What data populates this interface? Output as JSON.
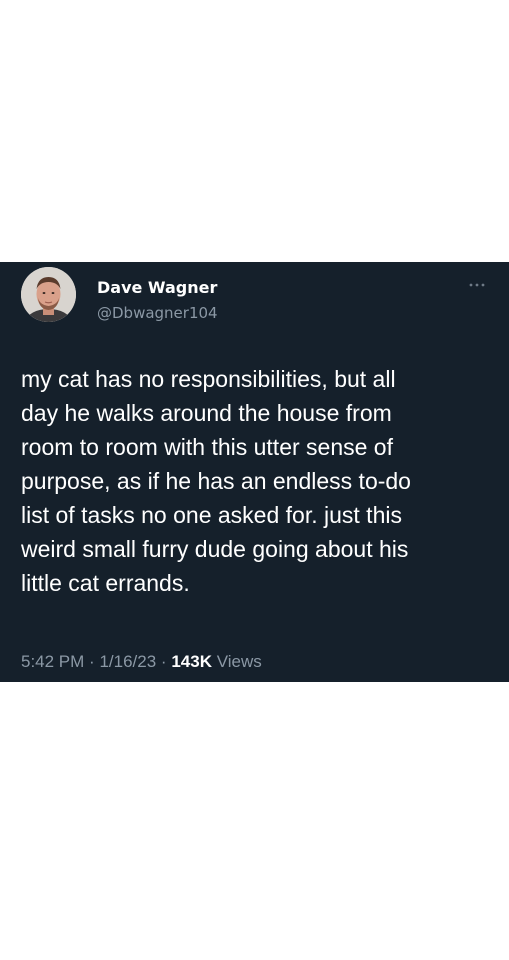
{
  "tweet": {
    "author": {
      "name": "Dave Wagner",
      "handle": "@Dbwagner104"
    },
    "more_icon": "more-horizontal-icon",
    "text": "my cat has no responsibilities, but all\nday he walks around the house from\nroom to room with this utter sense of\npurpose, as if he has an endless to-do\nlist of tasks no one asked for. just this\nweird small furry dude going about his\nlittle cat errands.",
    "meta": {
      "time": "5:42 PM",
      "separator": "·",
      "date": "1/16/23",
      "views_count": "143K",
      "views_label": "Views"
    }
  },
  "colors": {
    "card_background": "#15202b",
    "page_background": "#ffffff",
    "primary_text": "#ffffff",
    "secondary_text": "#8b98a5"
  }
}
